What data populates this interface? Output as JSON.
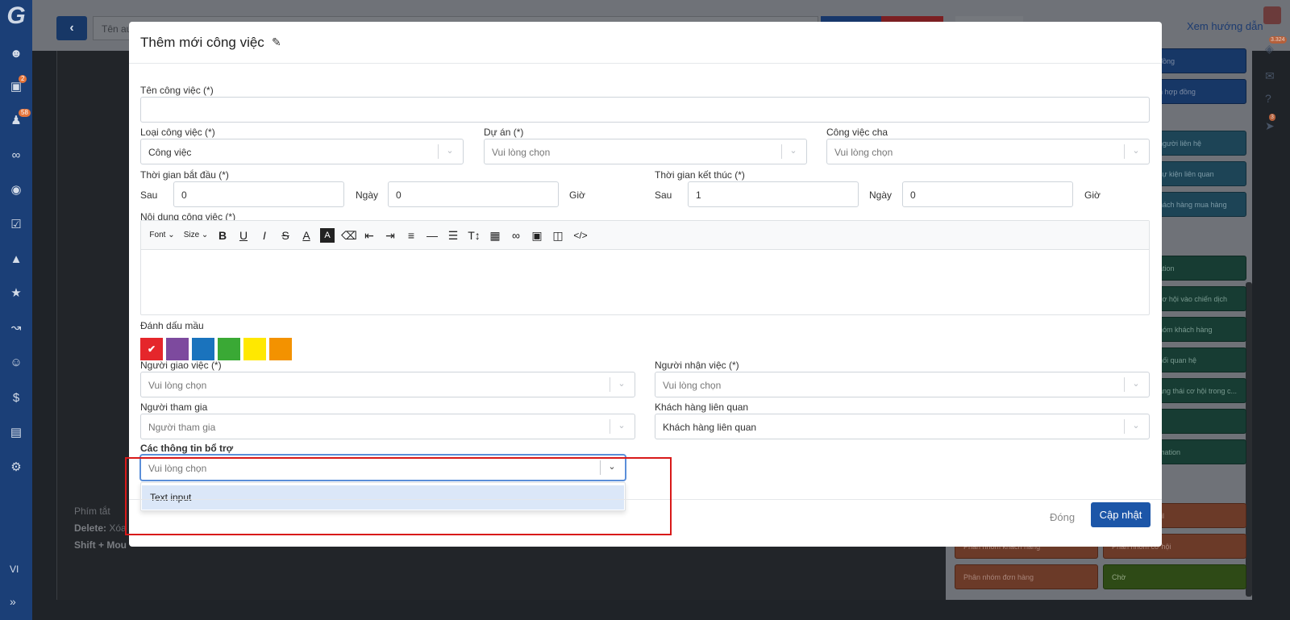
{
  "sidebar": {
    "logo": "G",
    "badges": {
      "briefcase": "2",
      "group": "58"
    },
    "lang": "VI"
  },
  "background": {
    "name_placeholder": "Tên au",
    "guide_link": "Xem hướng dẫn",
    "hints": {
      "title": "Phím tắt",
      "delete_key": "Delete:",
      "delete_text": "Xóa p",
      "shift_key": "Shift + Mou"
    },
    "right_badges": {
      "notifications": "3.324",
      "rocket": "3"
    },
    "nodes": {
      "blue": [
        "đồng",
        "n hợp đồng"
      ],
      "teal": [
        "người liên hệ",
        "sự kiện liên quan",
        "hách hàng mua hàng"
      ],
      "green": [
        "ation",
        "cơ hội vào chiến dịch",
        "hóm khách hàng",
        "nối quan hệ",
        "ạng thái cơ hội trong c...",
        "",
        "mation"
      ],
      "orange": [
        "g click link email",
        "Phân nhóm khách hàng",
        "Phân nhóm cơ hội",
        "Phân nhóm đơn hàng"
      ],
      "olive": [
        "Chờ"
      ]
    }
  },
  "modal": {
    "title": "Thêm mới công việc",
    "fields": {
      "task_name": {
        "label": "Tên công việc (*)",
        "value": ""
      },
      "task_type": {
        "label": "Loại công việc (*)",
        "value": "Công việc"
      },
      "project": {
        "label": "Dự án (*)",
        "placeholder": "Vui lòng chọn"
      },
      "parent_task": {
        "label": "Công việc cha",
        "placeholder": "Vui lòng chọn"
      },
      "start_time": {
        "label": "Thời gian bắt đầu (*)",
        "prefix": "Sau",
        "days": "0",
        "days_unit": "Ngày",
        "hours": "0",
        "hours_unit": "Giờ"
      },
      "end_time": {
        "label": "Thời gian kết thúc (*)",
        "prefix": "Sau",
        "days": "1",
        "days_unit": "Ngày",
        "hours": "0",
        "hours_unit": "Giờ"
      },
      "content": {
        "label": "Nội dung công việc (*)",
        "toolbar": {
          "font": "Font",
          "size": "Size"
        }
      },
      "color_mark": {
        "label": "Đánh dấu mầu",
        "colors": [
          "#e5262b",
          "#7d4a9e",
          "#1a73bd",
          "#3aa935",
          "#ffe800",
          "#f39200"
        ],
        "selected_index": 0
      },
      "assigner": {
        "label": "Người giao việc (*)",
        "placeholder": "Vui lòng chọn"
      },
      "assignee": {
        "label": "Người nhận việc (*)",
        "placeholder": "Vui lòng chọn"
      },
      "participants": {
        "label": "Người tham gia",
        "placeholder": "Người tham gia"
      },
      "related_customers": {
        "label": "Khách hàng liên quan",
        "value": "Khách hàng liên quan"
      },
      "extra_info": {
        "label": "Các thông tin bổ trợ",
        "placeholder": "Vui lòng chọn",
        "options": [
          "Text input"
        ]
      }
    },
    "footer": {
      "close": "Đóng",
      "update": "Cập nhật"
    }
  },
  "colors": {
    "primary": "#1c56a8",
    "sidebar": "#1b3f77",
    "highlight": "#d81a1a"
  }
}
